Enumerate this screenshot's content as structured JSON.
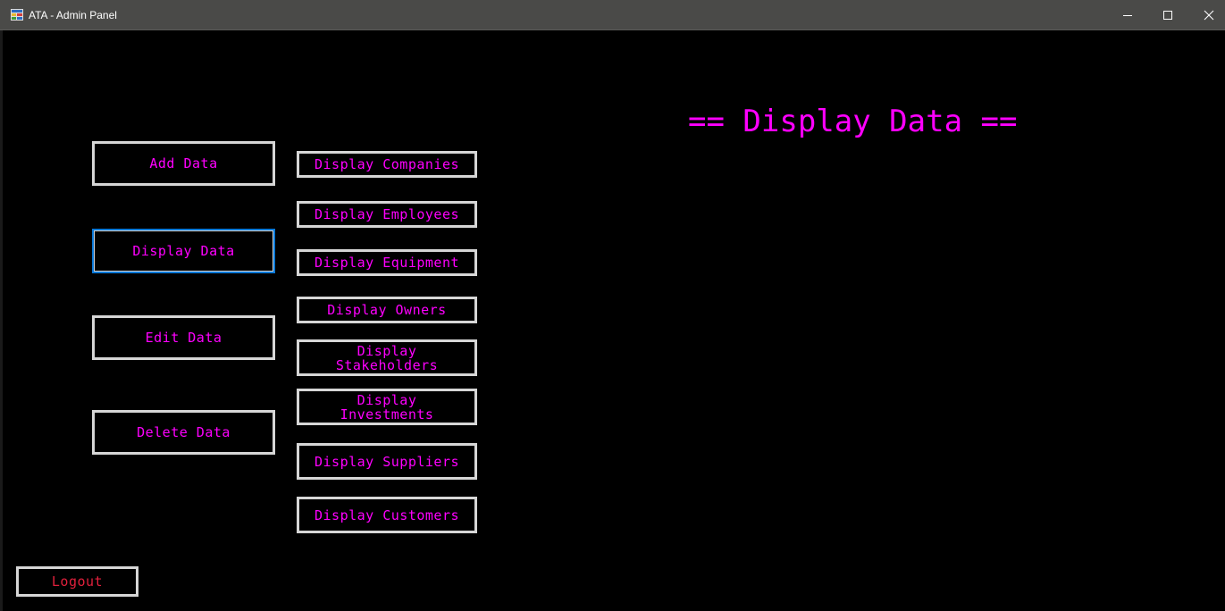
{
  "window": {
    "title": "ATA - Admin Panel"
  },
  "heading": "== Display Data ==",
  "main_menu": {
    "add": "Add Data",
    "display": "Display Data",
    "edit": "Edit Data",
    "delete": "Delete Data"
  },
  "display_menu": {
    "companies": "Display Companies",
    "employees": "Display Employees",
    "equipment": "Display Equipment",
    "owners": "Display Owners",
    "stakeholders": "Display Stakeholders",
    "investments": "Display Investments",
    "suppliers": "Display Suppliers",
    "customers": "Display Customers"
  },
  "logout": "Logout",
  "colors": {
    "text_accent": "#ff00ff",
    "logout_text": "#e0203c",
    "button_border": "#d6d6d6",
    "focus_border": "#0a78d7",
    "background": "#000000",
    "titlebar": "#4a4a48"
  },
  "icons": {
    "app": "app-icon",
    "minimize": "minimize-icon",
    "maximize": "maximize-icon",
    "close": "close-icon"
  }
}
